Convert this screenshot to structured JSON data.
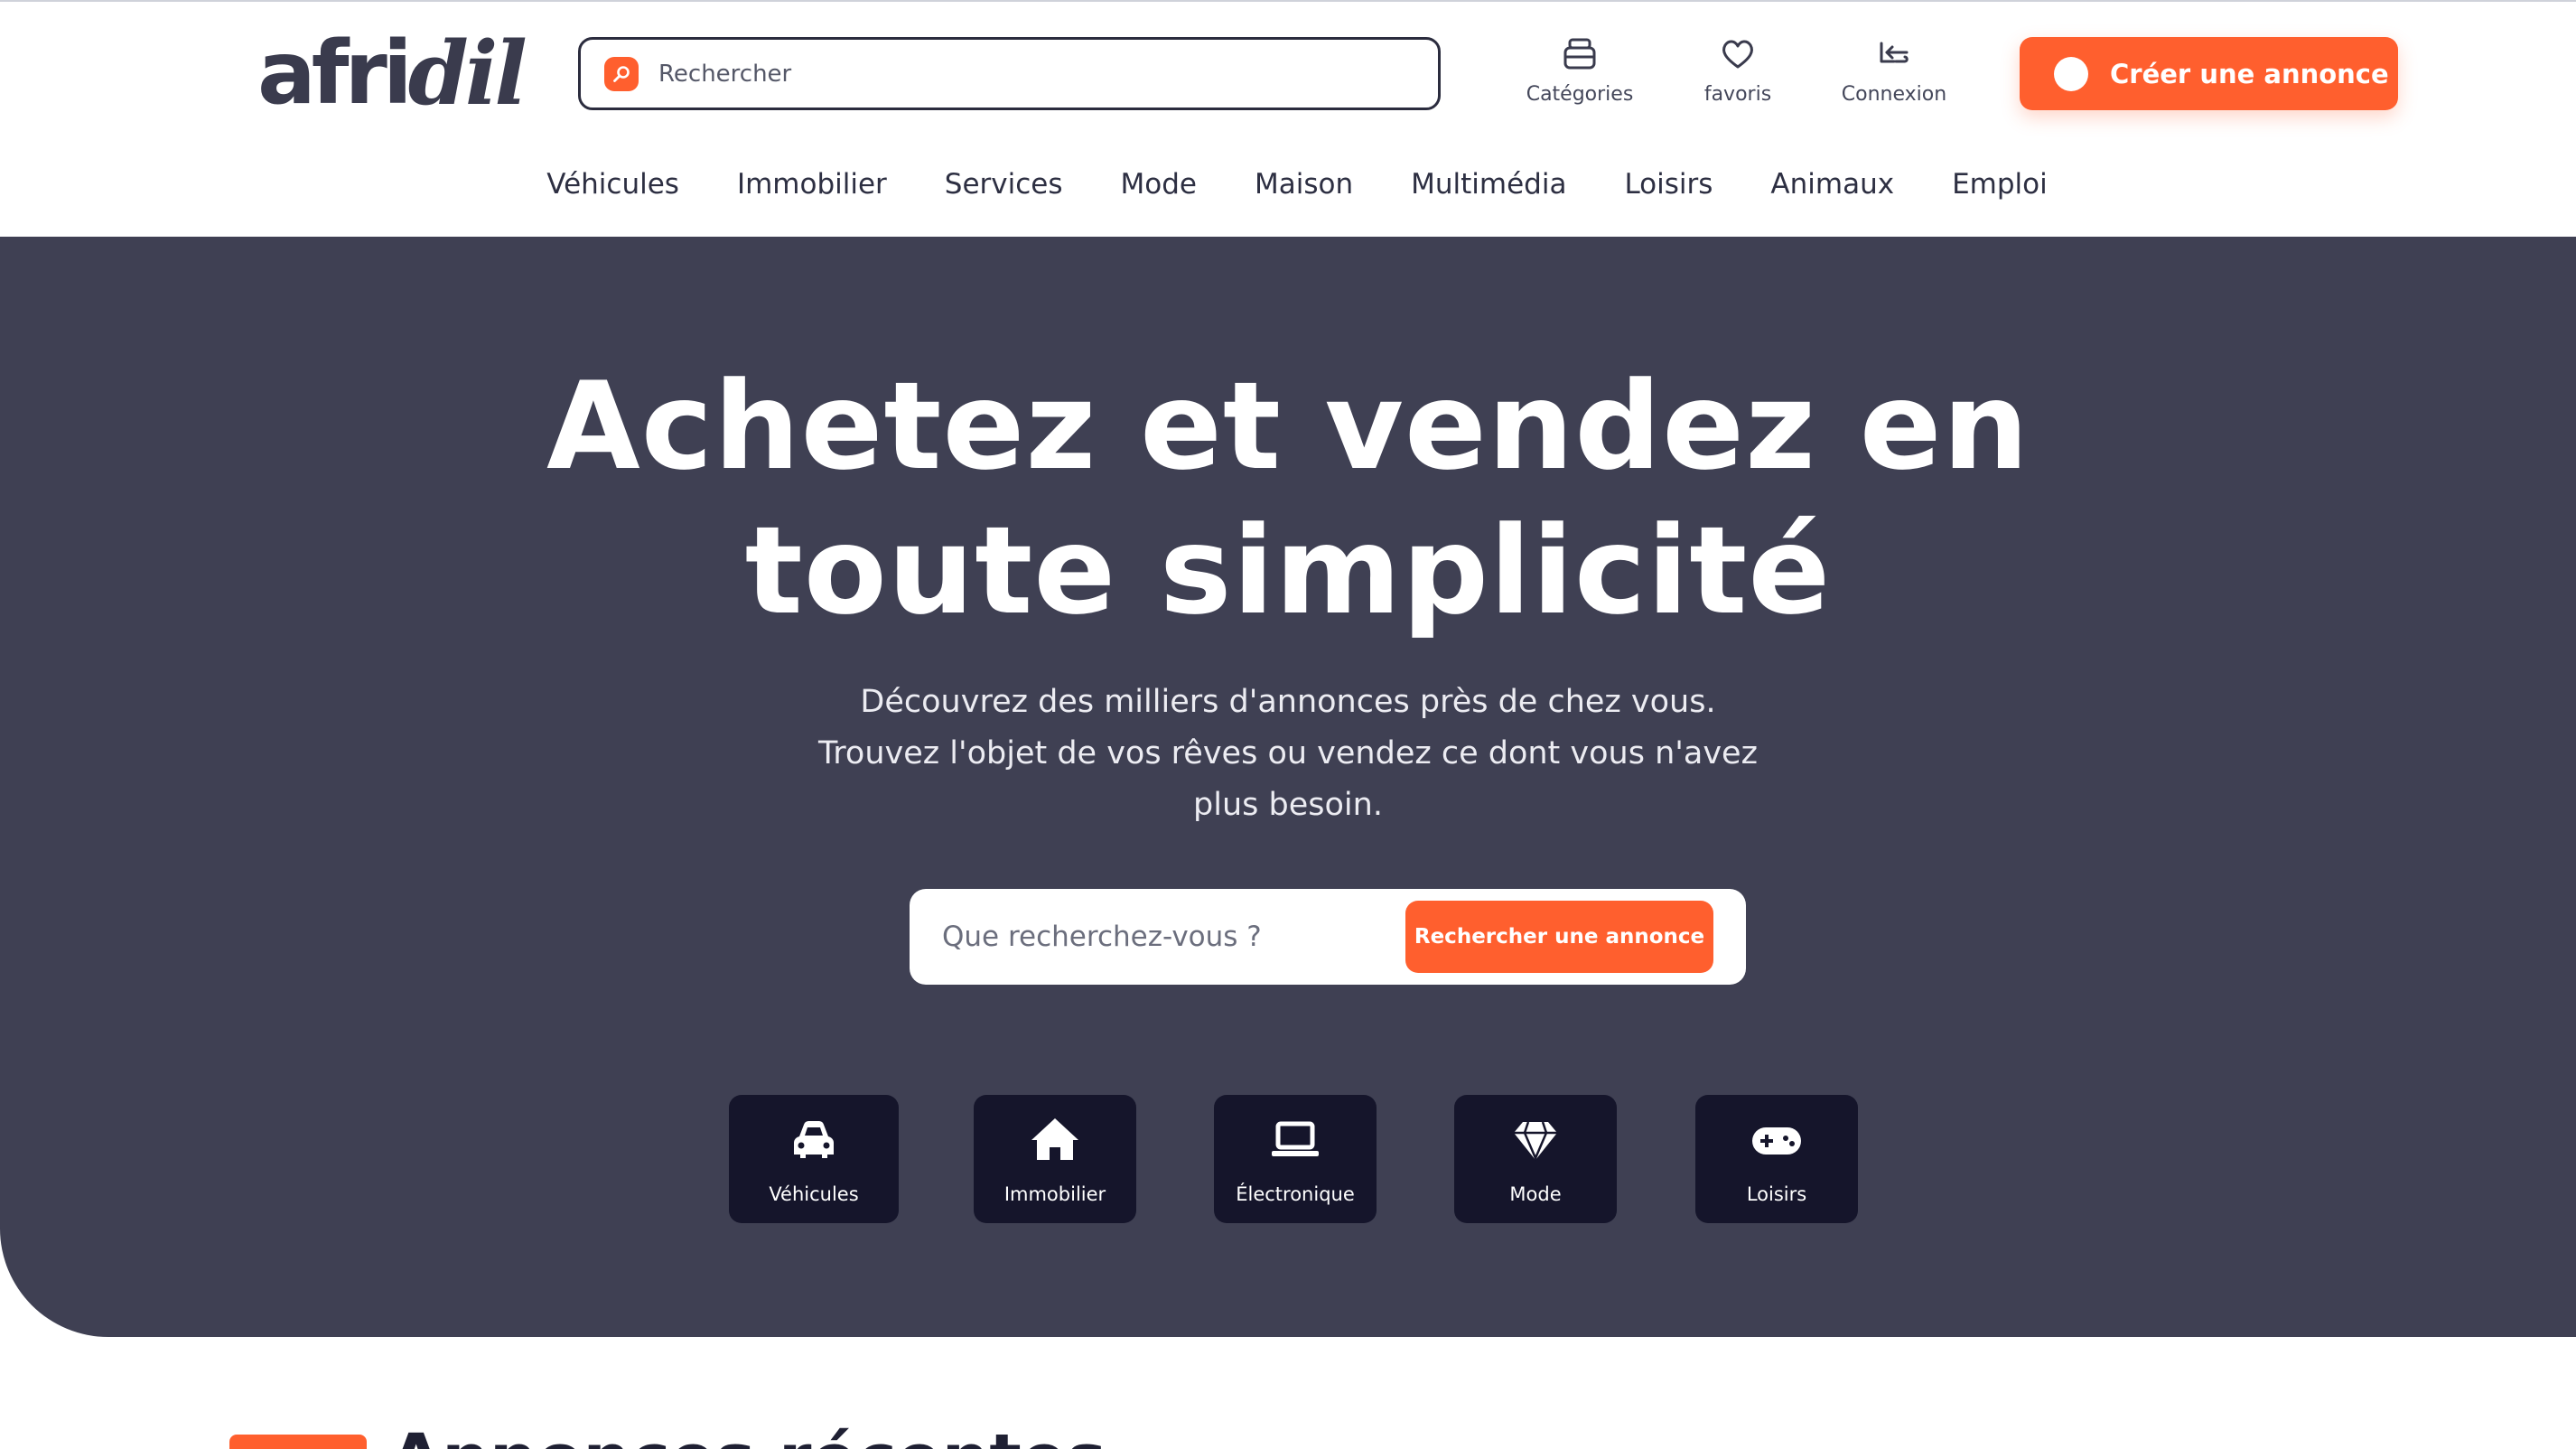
{
  "header": {
    "logo_text_plain": "afri",
    "logo_text_italic": "dil",
    "search_placeholder": "Rechercher",
    "actions": [
      {
        "label": "Catégories",
        "icon": "basket-icon"
      },
      {
        "label": "favoris",
        "icon": "heart-icon"
      },
      {
        "label": "Connexion",
        "icon": "login-hand-icon"
      }
    ],
    "cta_label": "Créer une annonce"
  },
  "nav": {
    "items": [
      "Véhicules",
      "Immobilier",
      "Services",
      "Mode",
      "Maison",
      "Multimédia",
      "Loisirs",
      "Animaux",
      "Emploi"
    ]
  },
  "hero": {
    "title": "Achetez et vendez en toute simplicité",
    "subtitle": "Découvrez des milliers d'annonces près de chez vous. Trouvez l'objet de vos rêves ou vendez ce dont vous n'avez plus besoin.",
    "search_placeholder": "Que recherchez-vous ?",
    "search_button": "Rechercher une annonce",
    "categories": [
      {
        "label": "Véhicules",
        "icon": "car-icon"
      },
      {
        "label": "Immobilier",
        "icon": "house-icon"
      },
      {
        "label": "Électronique",
        "icon": "laptop-icon"
      },
      {
        "label": "Mode",
        "icon": "diamond-icon"
      },
      {
        "label": "Loisirs",
        "icon": "gamepad-icon"
      }
    ]
  },
  "recent": {
    "title": "Annonces récentes"
  },
  "colors": {
    "accent": "#ff5f2e",
    "hero_bg": "#3f4053",
    "tile_bg": "#15152b",
    "text_dark": "#1f2033"
  }
}
